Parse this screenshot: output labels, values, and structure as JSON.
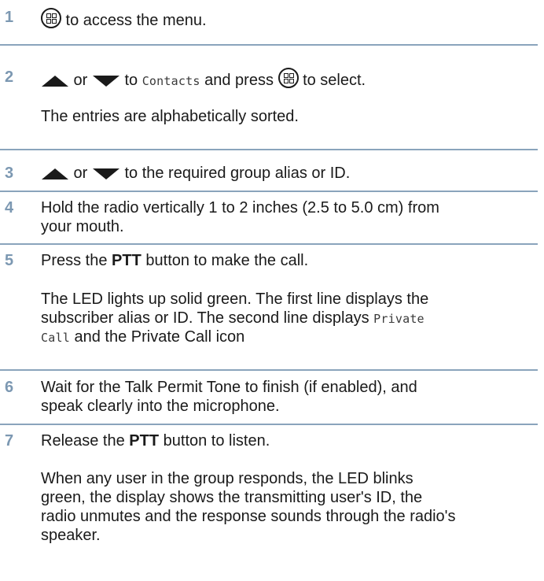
{
  "steps": [
    {
      "num": "1",
      "text": " to access the menu."
    },
    {
      "num": "2",
      "t_or": " or ",
      "t_to": " to ",
      "t_item": "Contacts",
      "t_press": " and press ",
      "t_select": " to select.",
      "note": "The entries are alphabetically sorted."
    },
    {
      "num": "3",
      "t_or": " or ",
      "t_rest": " to the required group alias or ID."
    },
    {
      "num": "4",
      "line1": "Hold the radio vertically 1 to 2 inches (2.5 to 5.0 cm) from",
      "line2": "your mouth."
    },
    {
      "num": "5",
      "t_pre": "Press the ",
      "t_bold": "PTT",
      "t_post": " button to make the call.",
      "note_l1": "The LED lights up solid green.  The first line displays the",
      "note_l2a": "subscriber alias or ID. The second line displays ",
      "note_mono1": "Private",
      "note_mono2": "Call",
      "note_l3b": " and the Private Call icon"
    },
    {
      "num": "6",
      "line1": "Wait for the Talk Permit Tone to finish (if enabled), and",
      "line2": "speak clearly into the microphone."
    },
    {
      "num": "7",
      "t_pre": "Release the ",
      "t_bold": "PTT",
      "t_post": " button to listen.",
      "note_l1": "When any user in the group responds, the LED blinks",
      "note_l2": "green, the display shows the transmitting user's ID, the",
      "note_l3": "radio unmutes and the response sounds through the radio's",
      "note_l4": "speaker."
    }
  ],
  "icons": {
    "menu": "menu-ok-key-icon",
    "up": "up-arrow-icon",
    "down": "down-arrow-icon"
  }
}
